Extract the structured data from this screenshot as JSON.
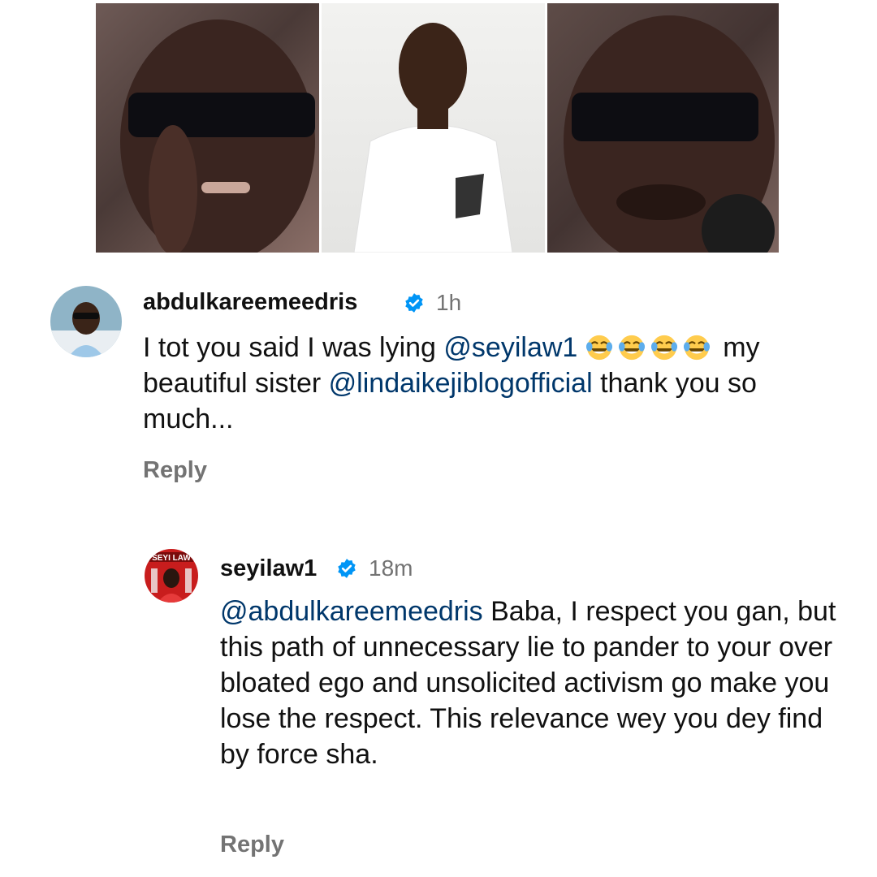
{
  "media": {
    "panels": [
      {
        "icon": "photo-man-sunglasses-pointing"
      },
      {
        "icon": "photo-man-white-outfit"
      },
      {
        "icon": "photo-man-sunglasses-speaking"
      }
    ]
  },
  "comments": [
    {
      "username": "abdulkareemeedris",
      "time": "1h",
      "text_segments": [
        {
          "type": "text",
          "value": "I tot you said I was lying "
        },
        {
          "type": "mention",
          "value": "@seyilaw1"
        },
        {
          "type": "text",
          "value": " "
        },
        {
          "type": "emoji",
          "value": "😂"
        },
        {
          "type": "emoji",
          "value": "😂"
        },
        {
          "type": "emoji",
          "value": "😂"
        },
        {
          "type": "emoji",
          "value": "😂"
        },
        {
          "type": "text",
          "value": " my beautiful sister "
        },
        {
          "type": "mention",
          "value": "@lindaikejiblogofficial"
        },
        {
          "type": "text",
          "value": " thank you so much..."
        }
      ],
      "reply_label": "Reply"
    },
    {
      "username": "seyilaw1",
      "time": "18m",
      "avatar_text": "SEYI LAW",
      "text_segments": [
        {
          "type": "mention",
          "value": "@abdulkareemeedris"
        },
        {
          "type": "text",
          "value": " Baba, I respect you gan, but this path of unnecessary lie to pander to your over bloated ego and unsolicited activism go make you lose the respect. This relevance wey you dey find by force sha."
        }
      ],
      "reply_label": "Reply"
    }
  ],
  "colors": {
    "mention": "#00376b",
    "verified": "#0095f6",
    "meta": "#737373"
  }
}
